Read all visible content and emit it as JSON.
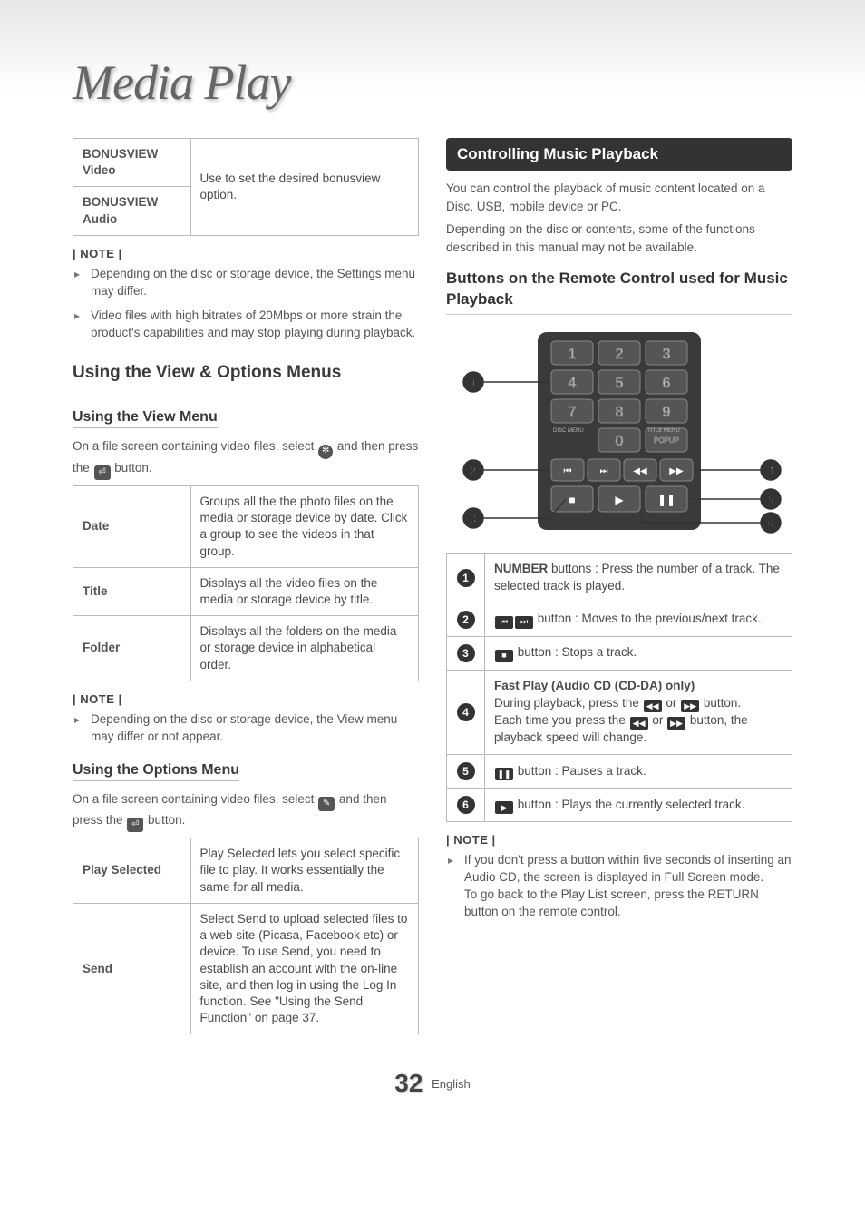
{
  "title": "Media Play",
  "left": {
    "bonus_table": {
      "rows": [
        {
          "key": "BONUSVIEW Video",
          "desc": "Use to set the desired bonusview option."
        },
        {
          "key": "BONUSVIEW Audio",
          "desc": ""
        }
      ]
    },
    "note_label_1": "| NOTE |",
    "notes_1": [
      "Depending on the disc or storage device, the Settings menu may differ.",
      "Video files with high bitrates of 20Mbps or more strain the product's capabilities and may stop playing during playback."
    ],
    "h_view_options": "Using the View & Options Menus",
    "h_view": "Using the View Menu",
    "view_menu_intro_1": "On a file screen containing video files, select ",
    "view_menu_intro_2": " and then press the ",
    "view_menu_intro_3": " button.",
    "view_icon_inline": "✻",
    "enter_icon_inline": "⏎",
    "view_table": {
      "rows": [
        {
          "key": "Date",
          "desc": "Groups all the the photo files on the media or storage device by date. Click a group to see the videos in that group."
        },
        {
          "key": "Title",
          "desc": "Displays all the video files on the media or storage device by title."
        },
        {
          "key": "Folder",
          "desc": "Displays all the folders on the media or storage device in alphabetical order."
        }
      ]
    },
    "note_label_2": "| NOTE |",
    "notes_2": [
      "Depending on the disc or storage device, the View menu may differ or not appear."
    ],
    "h_options": "Using the Options Menu",
    "options_intro_1": "On a file screen containing video files, select ",
    "options_intro_2": " and then press the ",
    "options_intro_3": " button.",
    "options_icon_inline": "✎",
    "options_table": {
      "rows": [
        {
          "key": "Play Selected",
          "desc": "Play Selected lets you select specific file to play. It works essentially the same for all media."
        },
        {
          "key": "Send",
          "desc": "Select Send to upload selected files to a web site (Picasa, Facebook etc) or device. To use Send, you need to establish an account with the on-line site, and then log in using the Log In function. See \"Using the Send Function\" on page 37."
        }
      ]
    }
  },
  "right": {
    "section_bar": "Controlling Music Playback",
    "intro_p1": "You can control the playback of music content located on a Disc, USB, mobile device or PC.",
    "intro_p2": "Depending on the disc or contents, some of the functions described in this manual may not be available.",
    "sub_heading": "Buttons on the Remote Control used for Music Playback",
    "remote": {
      "disc_menu": "DISC MENU",
      "title_menu": "TITLE MENU",
      "popup": "POPUP"
    },
    "callouts": [
      {
        "n": "1",
        "strong": "NUMBER",
        "text": " buttons : Press the number of a track. The selected track is played."
      },
      {
        "n": "2",
        "pre_icons": [
          "⏮",
          "⏭"
        ],
        "text": " button : Moves to the previous/next track."
      },
      {
        "n": "3",
        "pre_icons": [
          "■"
        ],
        "text": " button : Stops a track."
      },
      {
        "n": "4",
        "heading": "Fast Play (Audio CD (CD-DA) only)",
        "line1a": "During playback, press the ",
        "line1_icons": [
          "◀◀",
          "▶▶"
        ],
        "line1b": " button.",
        "line2a": "Each time you press the ",
        "line2_icons": [
          "◀◀",
          "▶▶"
        ],
        "line2b": " button, the playback speed will change."
      },
      {
        "n": "5",
        "pre_icons": [
          "❚❚"
        ],
        "text": " button : Pauses a track."
      },
      {
        "n": "6",
        "pre_icons": [
          "▶"
        ],
        "text": " button : Plays the currently selected track."
      }
    ],
    "note_label": "| NOTE |",
    "notes": [
      "If you don't press a button within five seconds of inserting an Audio CD, the screen is displayed in Full Screen mode.\nTo go back to the Play List screen, press the RETURN button on the remote control."
    ]
  },
  "footer": {
    "page": "32",
    "lang": "English"
  }
}
